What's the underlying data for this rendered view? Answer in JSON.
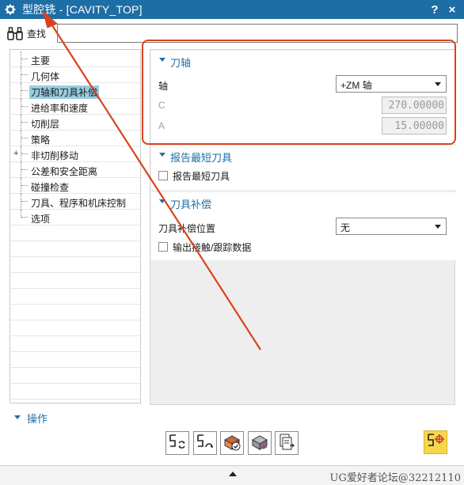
{
  "window": {
    "title": "型腔铣 - [CAVITY_TOP]",
    "help_label": "?",
    "close_label": "×"
  },
  "find": {
    "label": "查找",
    "value": ""
  },
  "tree": {
    "items": [
      {
        "label": "主要",
        "selected": false,
        "expandable": false
      },
      {
        "label": "几何体",
        "selected": false,
        "expandable": false
      },
      {
        "label": "刀轴和刀具补偿",
        "selected": true,
        "expandable": false
      },
      {
        "label": "进给率和速度",
        "selected": false,
        "expandable": false
      },
      {
        "label": "切削层",
        "selected": false,
        "expandable": false
      },
      {
        "label": "策略",
        "selected": false,
        "expandable": false
      },
      {
        "label": "非切削移动",
        "selected": false,
        "expandable": true
      },
      {
        "label": "公差和安全距离",
        "selected": false,
        "expandable": false
      },
      {
        "label": "碰撞检查",
        "selected": false,
        "expandable": false
      },
      {
        "label": "刀具、程序和机床控制",
        "selected": false,
        "expandable": false
      },
      {
        "label": "选项",
        "selected": false,
        "expandable": false
      }
    ],
    "expand_glyph": "+"
  },
  "tool_axis": {
    "title": "刀轴",
    "axis_label": "轴",
    "axis_value": "+ZM 轴",
    "c_label": "C",
    "c_value": "270.00000",
    "a_label": "A",
    "a_value": "15.00000"
  },
  "report_shortest": {
    "title": "报告最短刀具",
    "checkbox_label": "报告最短刀具",
    "checked": false
  },
  "tool_comp": {
    "title": "刀具补偿",
    "position_label": "刀具补偿位置",
    "position_value": "无",
    "output_checkbox_label": "输出接触/跟踪数据",
    "output_checked": false
  },
  "actions": {
    "title": "操作",
    "buttons": [
      "generate-icon",
      "replay-icon",
      "verify-icon",
      "simulate-icon",
      "list-icon",
      "confirm-toolpath-icon"
    ]
  },
  "watermark": "UG爱好者论坛@32212110",
  "colors": {
    "accent": "#1e6ea6",
    "selection": "#98cde0",
    "callout": "#d9421e",
    "highlight": "#f7d74a"
  }
}
